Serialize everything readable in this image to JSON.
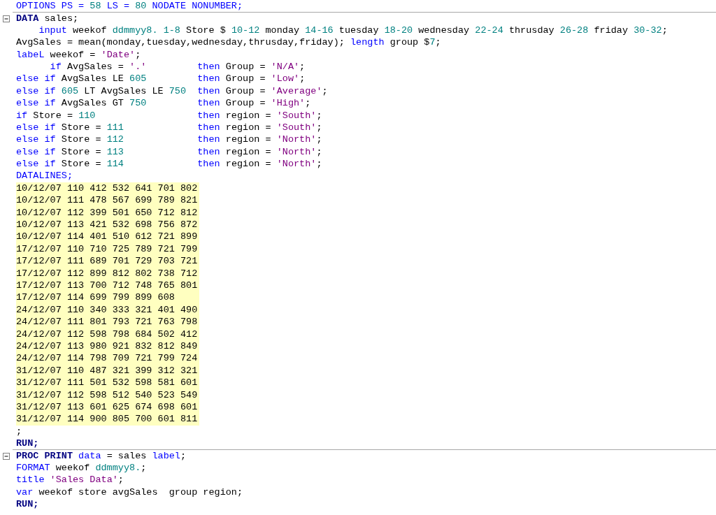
{
  "editor": {
    "lines": [
      {
        "kind": "code",
        "tokens": [
          {
            "keyword": "OPTIONS PS = "
          },
          {
            "number": "58"
          },
          {
            "keyword": " LS = "
          },
          {
            "number": "80"
          },
          {
            "keyword": " NODATE NONUMBER;"
          }
        ]
      },
      {
        "kind": "block_start",
        "expanded": true,
        "tokens": [
          {
            "step": "DATA"
          },
          {
            "plain": " sales;"
          }
        ]
      },
      {
        "kind": "code",
        "tokens": [
          {
            "keyword": "    input"
          },
          {
            "plain": " weekof "
          },
          {
            "format": "ddmmyy8."
          },
          {
            "number": " 1-8"
          },
          {
            "plain": " Store $ "
          },
          {
            "number": "10-12"
          },
          {
            "plain": " monday "
          },
          {
            "number": "14-16"
          },
          {
            "plain": " tuesday "
          },
          {
            "number": "18-20"
          },
          {
            "plain": " wednesday "
          },
          {
            "number": "22-24"
          },
          {
            "plain": " thrusday "
          },
          {
            "number": "26-28"
          },
          {
            "plain": " friday "
          },
          {
            "number": "30-32"
          },
          {
            "plain": ";"
          }
        ]
      },
      {
        "kind": "code",
        "tokens": [
          {
            "plain": "AvgSales = mean(monday,tuesday,wednesday,thrusday,friday); "
          },
          {
            "keyword": "length"
          },
          {
            "plain": " group $"
          },
          {
            "number": "7"
          },
          {
            "plain": ";"
          }
        ]
      },
      {
        "kind": "code",
        "tokens": [
          {
            "keyword": "labeL"
          },
          {
            "plain": " weekof = "
          },
          {
            "string": "'Date'"
          },
          {
            "plain": ";"
          }
        ]
      },
      {
        "kind": "code",
        "tokens": [
          {
            "keyword": "      if"
          },
          {
            "plain": " AvgSales = "
          },
          {
            "string": "'.'"
          },
          {
            "keyword": "         then"
          },
          {
            "plain": " Group = "
          },
          {
            "string": "'N/A'"
          },
          {
            "plain": ";"
          }
        ]
      },
      {
        "kind": "code",
        "tokens": [
          {
            "keyword": "else if"
          },
          {
            "plain": " AvgSales LE "
          },
          {
            "number": "605"
          },
          {
            "keyword": "         then"
          },
          {
            "plain": " Group = "
          },
          {
            "string": "'Low'"
          },
          {
            "plain": ";"
          }
        ]
      },
      {
        "kind": "code",
        "tokens": [
          {
            "keyword": "else if"
          },
          {
            "number": " 605"
          },
          {
            "plain": " LT AvgSales LE "
          },
          {
            "number": "750"
          },
          {
            "keyword": "  then"
          },
          {
            "plain": " Group = "
          },
          {
            "string": "'Average'"
          },
          {
            "plain": ";"
          }
        ]
      },
      {
        "kind": "code",
        "tokens": [
          {
            "keyword": "else if"
          },
          {
            "plain": " AvgSales GT "
          },
          {
            "number": "750"
          },
          {
            "keyword": "         then"
          },
          {
            "plain": " Group = "
          },
          {
            "string": "'High'"
          },
          {
            "plain": ";"
          }
        ]
      },
      {
        "kind": "code",
        "tokens": [
          {
            "keyword": "if"
          },
          {
            "plain": " Store = "
          },
          {
            "number": "110"
          },
          {
            "keyword": "                  then"
          },
          {
            "plain": " region = "
          },
          {
            "string": "'South'"
          },
          {
            "plain": ";"
          }
        ]
      },
      {
        "kind": "code",
        "tokens": [
          {
            "keyword": "else if"
          },
          {
            "plain": " Store = "
          },
          {
            "number": "111"
          },
          {
            "keyword": "             then"
          },
          {
            "plain": " region = "
          },
          {
            "string": "'South'"
          },
          {
            "plain": ";"
          }
        ]
      },
      {
        "kind": "code",
        "tokens": [
          {
            "keyword": "else if"
          },
          {
            "plain": " Store = "
          },
          {
            "number": "112"
          },
          {
            "keyword": "             then"
          },
          {
            "plain": " region = "
          },
          {
            "string": "'North'"
          },
          {
            "plain": ";"
          }
        ]
      },
      {
        "kind": "code",
        "tokens": [
          {
            "keyword": "else if"
          },
          {
            "plain": " Store = "
          },
          {
            "number": "113"
          },
          {
            "keyword": "             then"
          },
          {
            "plain": " region = "
          },
          {
            "string": "'North'"
          },
          {
            "plain": ";"
          }
        ]
      },
      {
        "kind": "code",
        "tokens": [
          {
            "keyword": "else if"
          },
          {
            "plain": " Store = "
          },
          {
            "number": "114"
          },
          {
            "keyword": "             then"
          },
          {
            "plain": " region = "
          },
          {
            "string": "'North'"
          },
          {
            "plain": ";"
          }
        ]
      },
      {
        "kind": "code",
        "tokens": [
          {
            "keyword": "DATALINES;"
          }
        ]
      },
      {
        "kind": "data",
        "text": "10/12/07 110 412 532 641 701 802"
      },
      {
        "kind": "data",
        "text": "10/12/07 111 478 567 699 789 821"
      },
      {
        "kind": "data",
        "text": "10/12/07 112 399 501 650 712 812"
      },
      {
        "kind": "data",
        "text": "10/12/07 113 421 532 698 756 872"
      },
      {
        "kind": "data",
        "text": "10/12/07 114 401 510 612 721 899"
      },
      {
        "kind": "data",
        "text": "17/12/07 110 710 725 789 721 799"
      },
      {
        "kind": "data",
        "text": "17/12/07 111 689 701 729 703 721"
      },
      {
        "kind": "data",
        "text": "17/12/07 112 899 812 802 738 712"
      },
      {
        "kind": "data",
        "text": "17/12/07 113 700 712 748 765 801"
      },
      {
        "kind": "data",
        "text": "17/12/07 114 699 799 899 608"
      },
      {
        "kind": "data",
        "text": "24/12/07 110 340 333 321 401 490"
      },
      {
        "kind": "data",
        "text": "24/12/07 111 801 793 721 763 798"
      },
      {
        "kind": "data",
        "text": "24/12/07 112 598 798 684 502 412"
      },
      {
        "kind": "data",
        "text": "24/12/07 113 980 921 832 812 849"
      },
      {
        "kind": "data",
        "text": "24/12/07 114 798 709 721 799 724"
      },
      {
        "kind": "data",
        "text": "31/12/07 110 487 321 399 312 321"
      },
      {
        "kind": "data",
        "text": "31/12/07 111 501 532 598 581 601"
      },
      {
        "kind": "data",
        "text": "31/12/07 112 598 512 540 523 549"
      },
      {
        "kind": "data",
        "text": "31/12/07 113 601 625 674 698 601"
      },
      {
        "kind": "data",
        "text": "31/12/07 114 900 805 700 601 811"
      },
      {
        "kind": "code",
        "tokens": [
          {
            "plain": ";"
          }
        ]
      },
      {
        "kind": "code",
        "tokens": [
          {
            "step": "RUN;"
          }
        ]
      },
      {
        "kind": "block_start",
        "expanded": true,
        "tokens": [
          {
            "step": "PROC PRINT"
          },
          {
            "keyword": " data"
          },
          {
            "plain": " = sales "
          },
          {
            "keyword": "label"
          },
          {
            "plain": ";"
          }
        ]
      },
      {
        "kind": "code",
        "tokens": [
          {
            "keyword": "FORMAT"
          },
          {
            "plain": " weekof "
          },
          {
            "format": "ddmmyy8."
          },
          {
            "plain": ";"
          }
        ]
      },
      {
        "kind": "code",
        "tokens": [
          {
            "keyword": "title"
          },
          {
            "string": " 'Sales Data'"
          },
          {
            "plain": ";"
          }
        ]
      },
      {
        "kind": "code",
        "tokens": [
          {
            "keyword": "var"
          },
          {
            "plain": " weekof store avgSales  group region;"
          }
        ]
      },
      {
        "kind": "code",
        "tokens": [
          {
            "step": "RUN;"
          }
        ]
      }
    ]
  }
}
